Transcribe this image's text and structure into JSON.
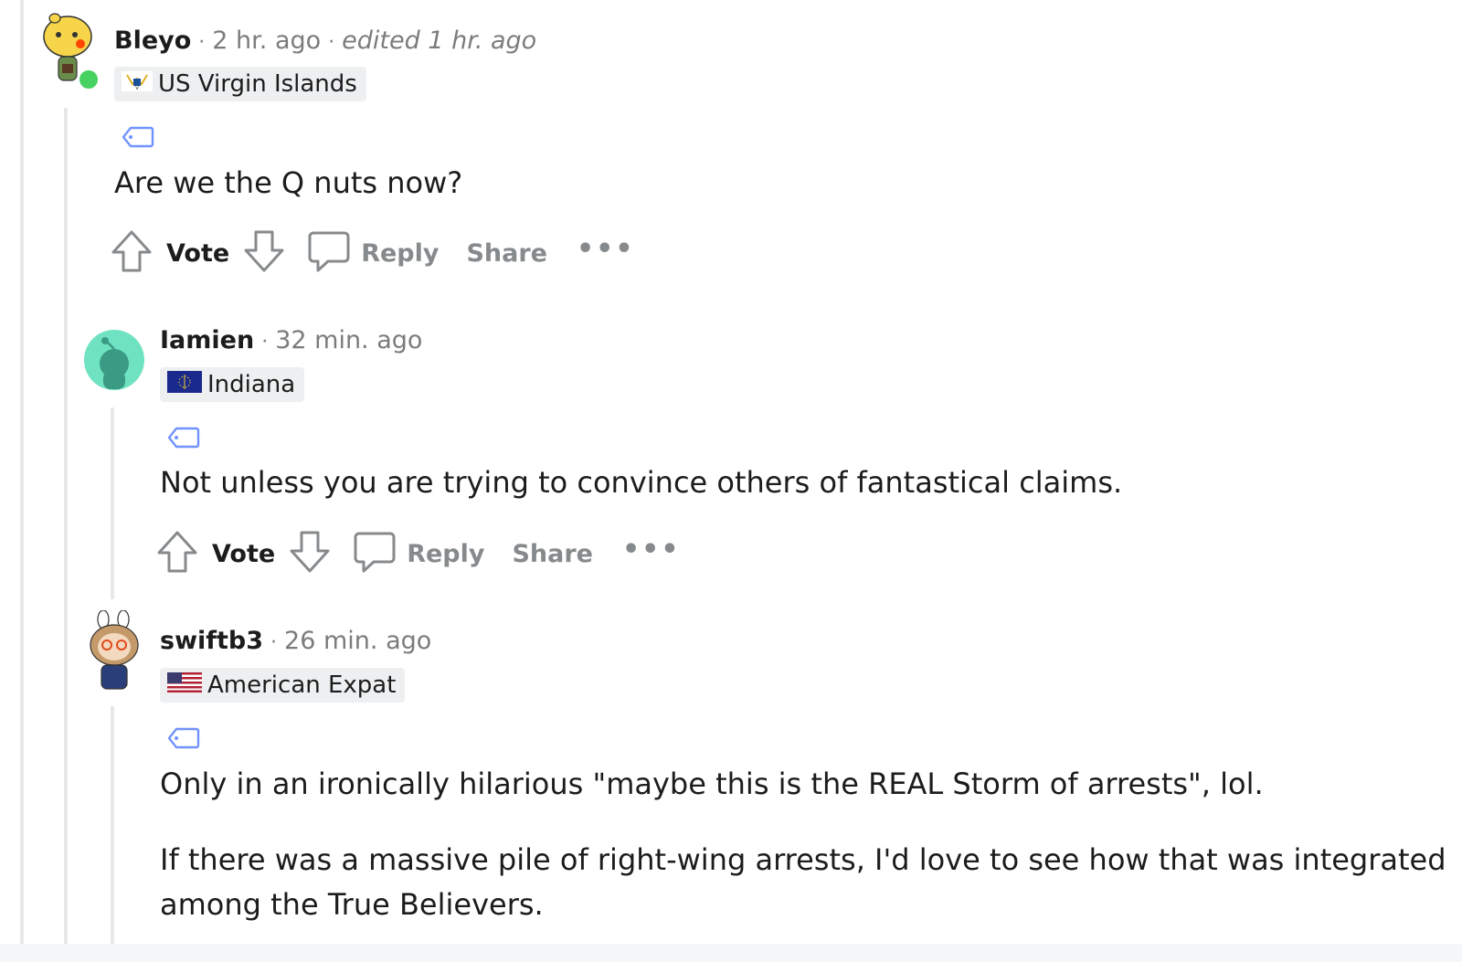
{
  "comments": [
    {
      "username": "Bleyo",
      "time": "2 hr. ago",
      "edited": "edited 1 hr. ago",
      "flair": "US Virgin Islands",
      "flair_flag": "us-virgin-islands-flag",
      "online": true,
      "body": [
        "Are we the Q nuts now?"
      ],
      "actions": {
        "vote": "Vote",
        "reply": "Reply",
        "share": "Share",
        "more": "•••"
      }
    },
    {
      "username": "Iamien",
      "time": "32 min. ago",
      "flair": "Indiana",
      "flair_flag": "indiana-flag",
      "body": [
        "Not unless you are trying to convince others of fantastical claims."
      ],
      "actions": {
        "vote": "Vote",
        "reply": "Reply",
        "share": "Share",
        "more": "•••"
      }
    },
    {
      "username": "swiftb3",
      "time": "26 min. ago",
      "flair": "American Expat",
      "flair_flag": "us-flag",
      "body": [
        "Only in an ironically hilarious \"maybe this is the REAL Storm of arrests\", lol.",
        "If there was a massive pile of right-wing arrests, I'd love to see how that was integrated",
        "among the True Believers."
      ]
    }
  ],
  "colors": {
    "online": "#46d160",
    "thread_line": "#e6e8ea",
    "flair_bg": "#edeff1",
    "meta_text": "#7c7c7c",
    "action_text": "#878a8c",
    "tag_icon": "#7193ff"
  }
}
